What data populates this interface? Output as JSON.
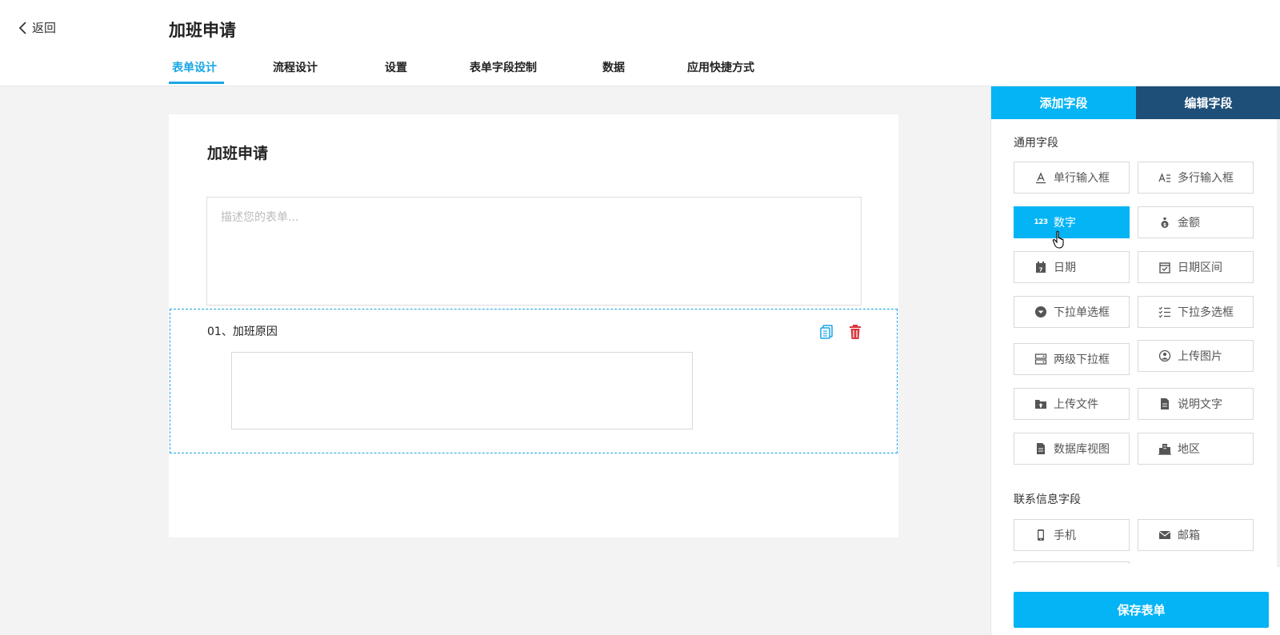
{
  "header": {
    "back_label": "返回",
    "title": "加班申请",
    "tabs": [
      {
        "label": "表单设计",
        "active": true
      },
      {
        "label": "流程设计"
      },
      {
        "label": "设置"
      },
      {
        "label": "表单字段控制"
      },
      {
        "label": "数据"
      },
      {
        "label": "应用快捷方式"
      }
    ]
  },
  "form": {
    "title": "加班申请",
    "description_placeholder": "描述您的表单...",
    "fields": [
      {
        "label": "01、加班原因"
      }
    ]
  },
  "panel": {
    "tab_add": "添加字段",
    "tab_edit": "编辑字段",
    "general_title": "通用字段",
    "general_fields": [
      {
        "label": "单行输入框",
        "icon": "text-line-icon"
      },
      {
        "label": "多行输入框",
        "icon": "text-multiline-icon"
      },
      {
        "label": "数字",
        "icon": "number-icon",
        "active": true
      },
      {
        "label": "金额",
        "icon": "money-bag-icon"
      },
      {
        "label": "日期",
        "icon": "calendar-icon"
      },
      {
        "label": "日期区间",
        "icon": "calendar-range-icon"
      },
      {
        "label": "下拉单选框",
        "icon": "dropdown-single-icon"
      },
      {
        "label": "下拉多选框",
        "icon": "dropdown-multi-icon"
      },
      {
        "label": "两级下拉框",
        "icon": "cascade-dropdown-icon"
      },
      {
        "label": "上传图片",
        "icon": "upload-image-icon"
      },
      {
        "label": "上传文件",
        "icon": "upload-file-icon"
      },
      {
        "label": "说明文字",
        "icon": "description-icon"
      },
      {
        "label": "数据库视图",
        "icon": "database-view-icon"
      },
      {
        "label": "地区",
        "icon": "region-icon"
      }
    ],
    "contact_title": "联系信息字段",
    "contact_fields": [
      {
        "label": "手机",
        "icon": "phone-icon"
      },
      {
        "label": "邮箱",
        "icon": "email-icon"
      }
    ],
    "save_label": "保存表单"
  },
  "colors": {
    "accent": "#04b4f5",
    "tab_active": "#18a6e6",
    "edit_tab": "#1d4f78",
    "delete": "#d9363e"
  }
}
